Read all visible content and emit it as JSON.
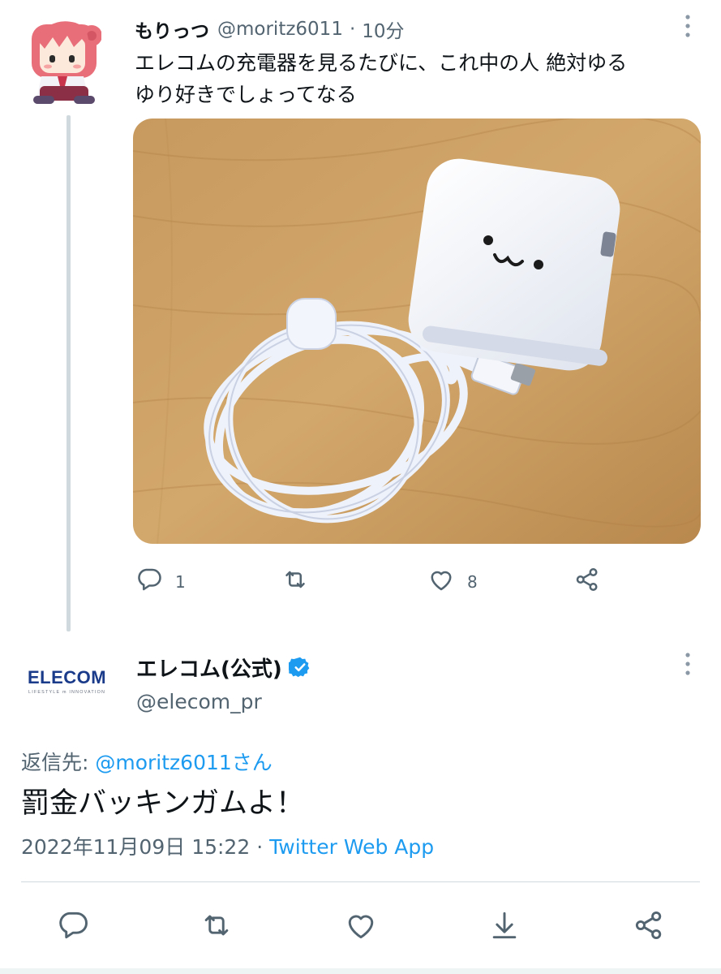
{
  "colors": {
    "text": "#0f1419",
    "muted": "#536471",
    "link": "#1d9bf0",
    "divider": "#cfd9de",
    "verified": "#1d9bf0"
  },
  "tweet1": {
    "name": "もりっつ",
    "handle": "@moritz6011",
    "dot": "·",
    "time": "10分",
    "text": "エレコムの充電器を見るたびに、これ中の人 絶対ゆる\nゆり好きでしょってなる",
    "actions": {
      "reply_icon": "reply-icon",
      "reply_count": "1",
      "retweet_icon": "retweet-icon",
      "like_icon": "heart-icon",
      "like_count": "8",
      "share_icon": "share-icon"
    }
  },
  "tweet2": {
    "logo_text": "ELECOM",
    "logo_tagline": "LIFESTYLE m INNOVATION",
    "name": "エレコム(公式)",
    "handle": "@elecom_pr",
    "reply_label": "返信先: ",
    "reply_mention": "@moritz6011さん",
    "text": "罰金バッキンガムよ！",
    "timestamp": "2022年11月09日 15:22",
    "dot": "·",
    "source": "Twitter Web App",
    "actions": [
      "reply-icon",
      "retweet-icon",
      "heart-icon",
      "download-icon",
      "share-icon"
    ]
  }
}
